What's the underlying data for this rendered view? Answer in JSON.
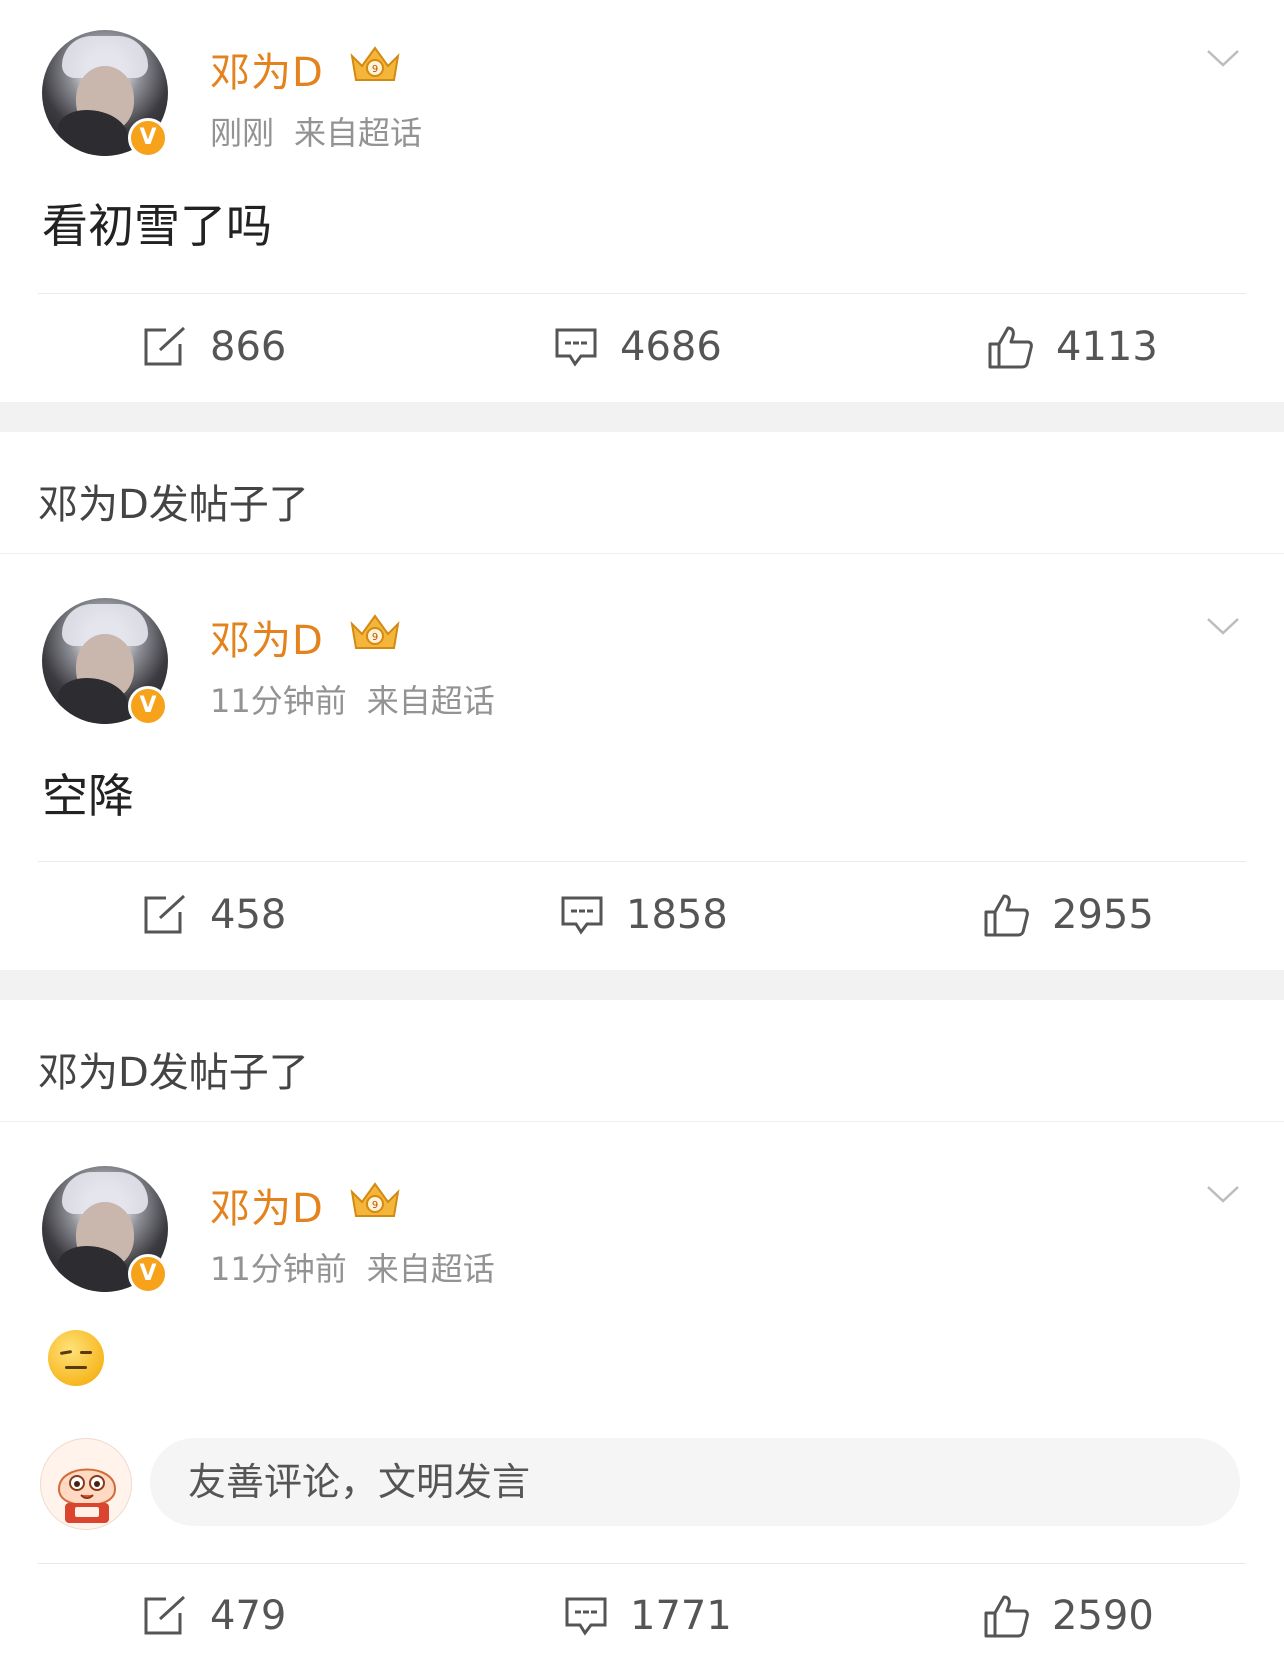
{
  "posts": [
    {
      "username": "邓为D",
      "time": "刚刚",
      "source": "来自超话",
      "content": "看初雪了吗",
      "reposts": "866",
      "comments": "4686",
      "likes": "4113"
    },
    {
      "username": "邓为D",
      "time": "11分钟前",
      "source": "来自超话",
      "content": "空降",
      "reposts": "458",
      "comments": "1858",
      "likes": "2955"
    },
    {
      "username": "邓为D",
      "time": "11分钟前",
      "source": "来自超话",
      "content_icon": "squinting-face-emoji",
      "comment_placeholder": "友善评论，文明发言",
      "reposts": "479",
      "comments": "1771",
      "likes": "2590"
    }
  ],
  "notifications": [
    "邓为D发帖子了",
    "邓为D发帖子了"
  ],
  "verified_badge": "V",
  "colors": {
    "username": "#e4831d",
    "badge": "#f7a21b",
    "meta": "#939393",
    "separator": "#f2f2f2"
  }
}
